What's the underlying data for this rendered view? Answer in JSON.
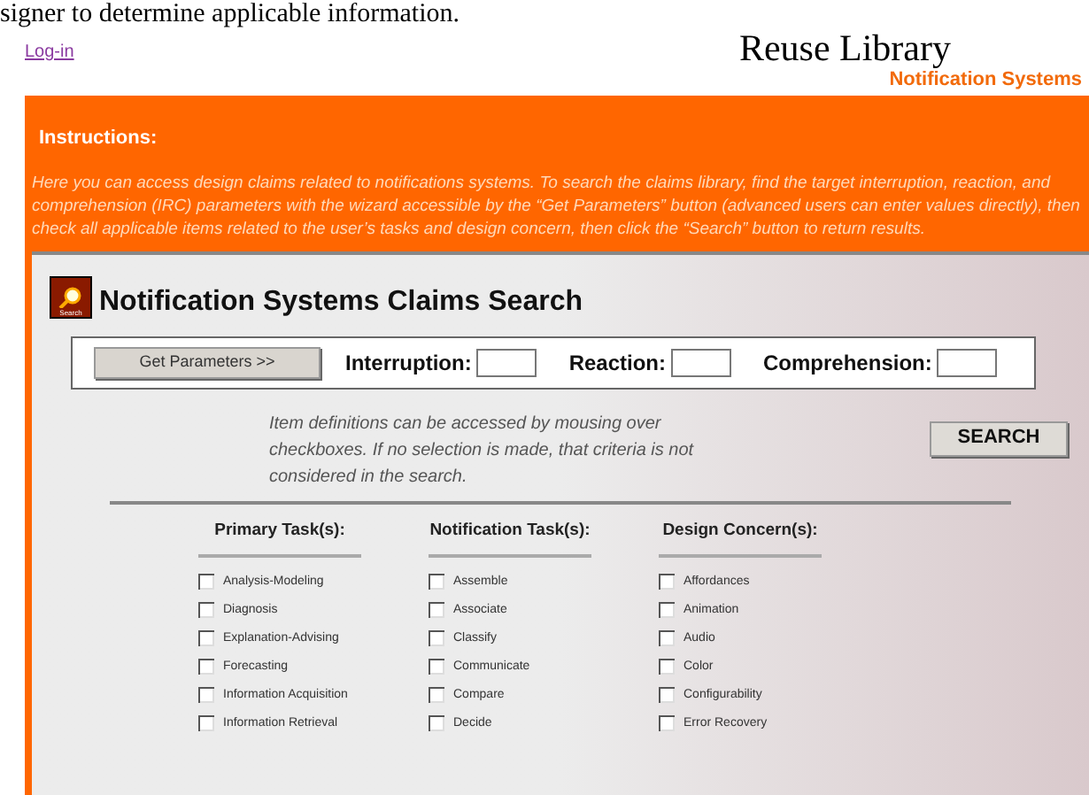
{
  "top_text": "signer to determine applicable information.",
  "login_link": "Log-in",
  "brand": {
    "title": "Reuse Library",
    "subtitle": "Notification Systems"
  },
  "instructions": {
    "heading": "Instructions:",
    "text": "Here you can access design claims related to notifications systems. To search the claims library, find the target interruption, reaction, and comprehension (IRC) parameters with the wizard accessible by the “Get Parameters” button (advanced users can enter values directly), then check all applicable items related to the user’s tasks and design concern, then click the “Search” button to return results."
  },
  "search_panel": {
    "icon_label": "Search",
    "title": "Notification Systems Claims Search",
    "get_parameters_button": "Get Parameters >>",
    "fields": [
      {
        "label": "Interruption:"
      },
      {
        "label": "Reaction:"
      },
      {
        "label": "Comprehension:"
      }
    ],
    "note": "Item definitions can be accessed by mousing over checkboxes. If no selection is made, that criteria is not considered in the search.",
    "search_button": "SEARCH",
    "columns": [
      {
        "heading": "Primary Task(s):",
        "items": [
          {
            "label": "Analysis-Modeling",
            "checked": false
          },
          {
            "label": "Diagnosis",
            "checked": false
          },
          {
            "label": "Explanation-Advising",
            "checked": false
          },
          {
            "label": "Forecasting",
            "checked": false
          },
          {
            "label": "Information Acquisition",
            "checked": false
          },
          {
            "label": "Information Retrieval",
            "checked": false
          }
        ]
      },
      {
        "heading": "Notification Task(s):",
        "items": [
          {
            "label": "Assemble",
            "checked": false
          },
          {
            "label": "Associate",
            "checked": false
          },
          {
            "label": "Classify",
            "checked": false
          },
          {
            "label": "Communicate",
            "checked": false
          },
          {
            "label": "Compare",
            "checked": false
          },
          {
            "label": "Decide",
            "checked": false
          }
        ]
      },
      {
        "heading": "Design Concern(s):",
        "items": [
          {
            "label": "Affordances",
            "checked": false
          },
          {
            "label": "Animation",
            "checked": false
          },
          {
            "label": "Audio",
            "checked": false
          },
          {
            "label": "Color",
            "checked": false
          },
          {
            "label": "Configurability",
            "checked": false
          },
          {
            "label": "Error Recovery",
            "checked": false
          }
        ]
      }
    ]
  }
}
